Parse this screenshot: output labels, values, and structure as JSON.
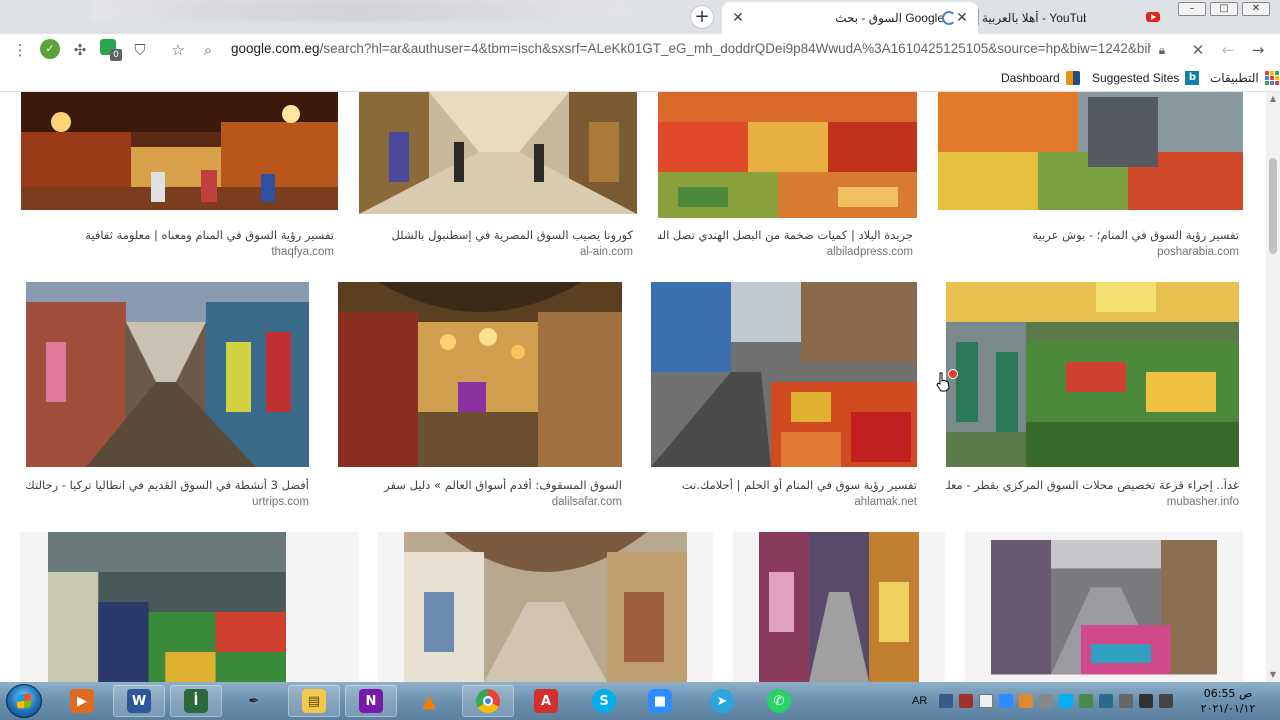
{
  "browser": {
    "tabs": [
      {
        "title": "السوق - بحث Google",
        "favicon": "google-loading-icon"
      },
      {
        "title": "أهلا بالعربية - YouTube",
        "favicon": "youtube-icon"
      }
    ],
    "new_tab_label": "+",
    "close_glyph": "✕",
    "window": {
      "minimize": "–",
      "maximize": "□",
      "close": "✕"
    },
    "url_host": "google.com.eg",
    "url_rest": "/search?hl=ar&authuser=4&tbm=isch&sxsrf=ALeKk01GT_eG_mh_doddrQDei9p84WwudA%3A1610425125105&source=hp&biw=1242&bih=…",
    "ext_badge_count": "0",
    "bookmarks": [
      {
        "label": "التطبيقات",
        "icon": "apps-grid-icon"
      },
      {
        "label": "Suggested Sites",
        "icon": "bing-icon"
      },
      {
        "label": "Dashboard",
        "icon": "dashboard-icon"
      }
    ]
  },
  "results": {
    "row1": [
      {
        "title": "تفسير رؤية السوق في المنام ومعناه | معلومة ثقافية",
        "source": "thaqfya.com"
      },
      {
        "title": "كورونا يصيب السوق المصرية في إسطنبول بالشلل",
        "source": "al-ain.com"
      },
      {
        "title": "جريدة البلاد | كميات ضخمة من البصل الهندي تصل السوق...",
        "source": "albiladpress.com"
      },
      {
        "title": "تفسير رؤية السوق في المنام؛ - بوش عربية",
        "source": "posharabia.com"
      }
    ],
    "row2": [
      {
        "title": "أفضل 3 أنشطة في السوق القديم في انطاليا تركيا - رحالتك",
        "source": "urtrips.com"
      },
      {
        "title": "السوق المسقوف: أقدم أسواق العالم » دليل سفر",
        "source": "dalilsafar.com"
      },
      {
        "title": "تفسير رؤية سوق في المنام أو الحلم | أحلامك.نت",
        "source": "ahlamak.net"
      },
      {
        "title": "غداً.. إجراء قرعة تخصيص محلات السوق المركزي بقطر - معلومات ...",
        "source": "mubasher.info"
      }
    ]
  },
  "taskbar": {
    "apps": [
      "windows-media-icon",
      "word-icon",
      "anaqa-app-icon",
      "pen-tool-icon",
      "file-explorer-icon",
      "onenote-icon",
      "vlc-icon",
      "chrome-icon",
      "acrobat-icon",
      "skype-icon",
      "zoom-icon",
      "telegram-icon",
      "whatsapp-icon"
    ],
    "lang": "AR",
    "time": "06:55 ص",
    "date": "٢٠٢١/٠١/١٢"
  },
  "colors": {
    "tabstrip": "#dee1e6",
    "link_source": "#70757a",
    "taskbar": "#6e93b0"
  }
}
